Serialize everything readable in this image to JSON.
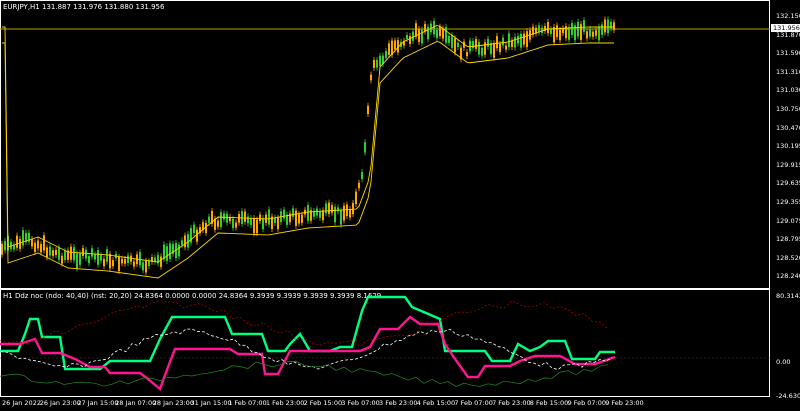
{
  "main_title": "EURJPY,H1  131.887 131.976 131.880 131.956",
  "sub_title": "H1 Ddz noc (ndo: 40,40) (nst: 20,20) 24.8364 0.0000 0.0000 24.8364 9.3939 9.3939 9.3939 9.3939 8.1629",
  "main_axis": [
    "132.150",
    "131.870",
    "131.590",
    "131.310",
    "131.030",
    "130.750",
    "130.470",
    "130.195",
    "129.915",
    "129.635",
    "129.355",
    "129.075",
    "128.795",
    "128.520",
    "128.240"
  ],
  "current_price": "131.956",
  "sub_axis": [
    "80.3143",
    "0.00",
    "-24.6304"
  ],
  "time_axis": [
    "26 Jan 2022",
    "26 Jan 23:00",
    "27 Jan 15:00",
    "28 Jan 07:00",
    "28 Jan 23:00",
    "31 Jan 15:00",
    "1 Feb 07:00",
    "1 Feb 23:00",
    "2 Feb 15:00",
    "3 Feb 07:00",
    "3 Feb 23:00",
    "4 Feb 15:00",
    "7 Feb 07:00",
    "7 Feb 23:00",
    "8 Feb 15:00",
    "9 Feb 07:00",
    "9 Feb 23:00"
  ],
  "colors": {
    "bull": "#32cd32",
    "bear": "#ffa500",
    "ma": "#ffd700",
    "hline": "#b8a000",
    "green": "#00ff7f",
    "pink": "#ff1493",
    "red": "#8b0000",
    "white": "#ffffff"
  }
}
